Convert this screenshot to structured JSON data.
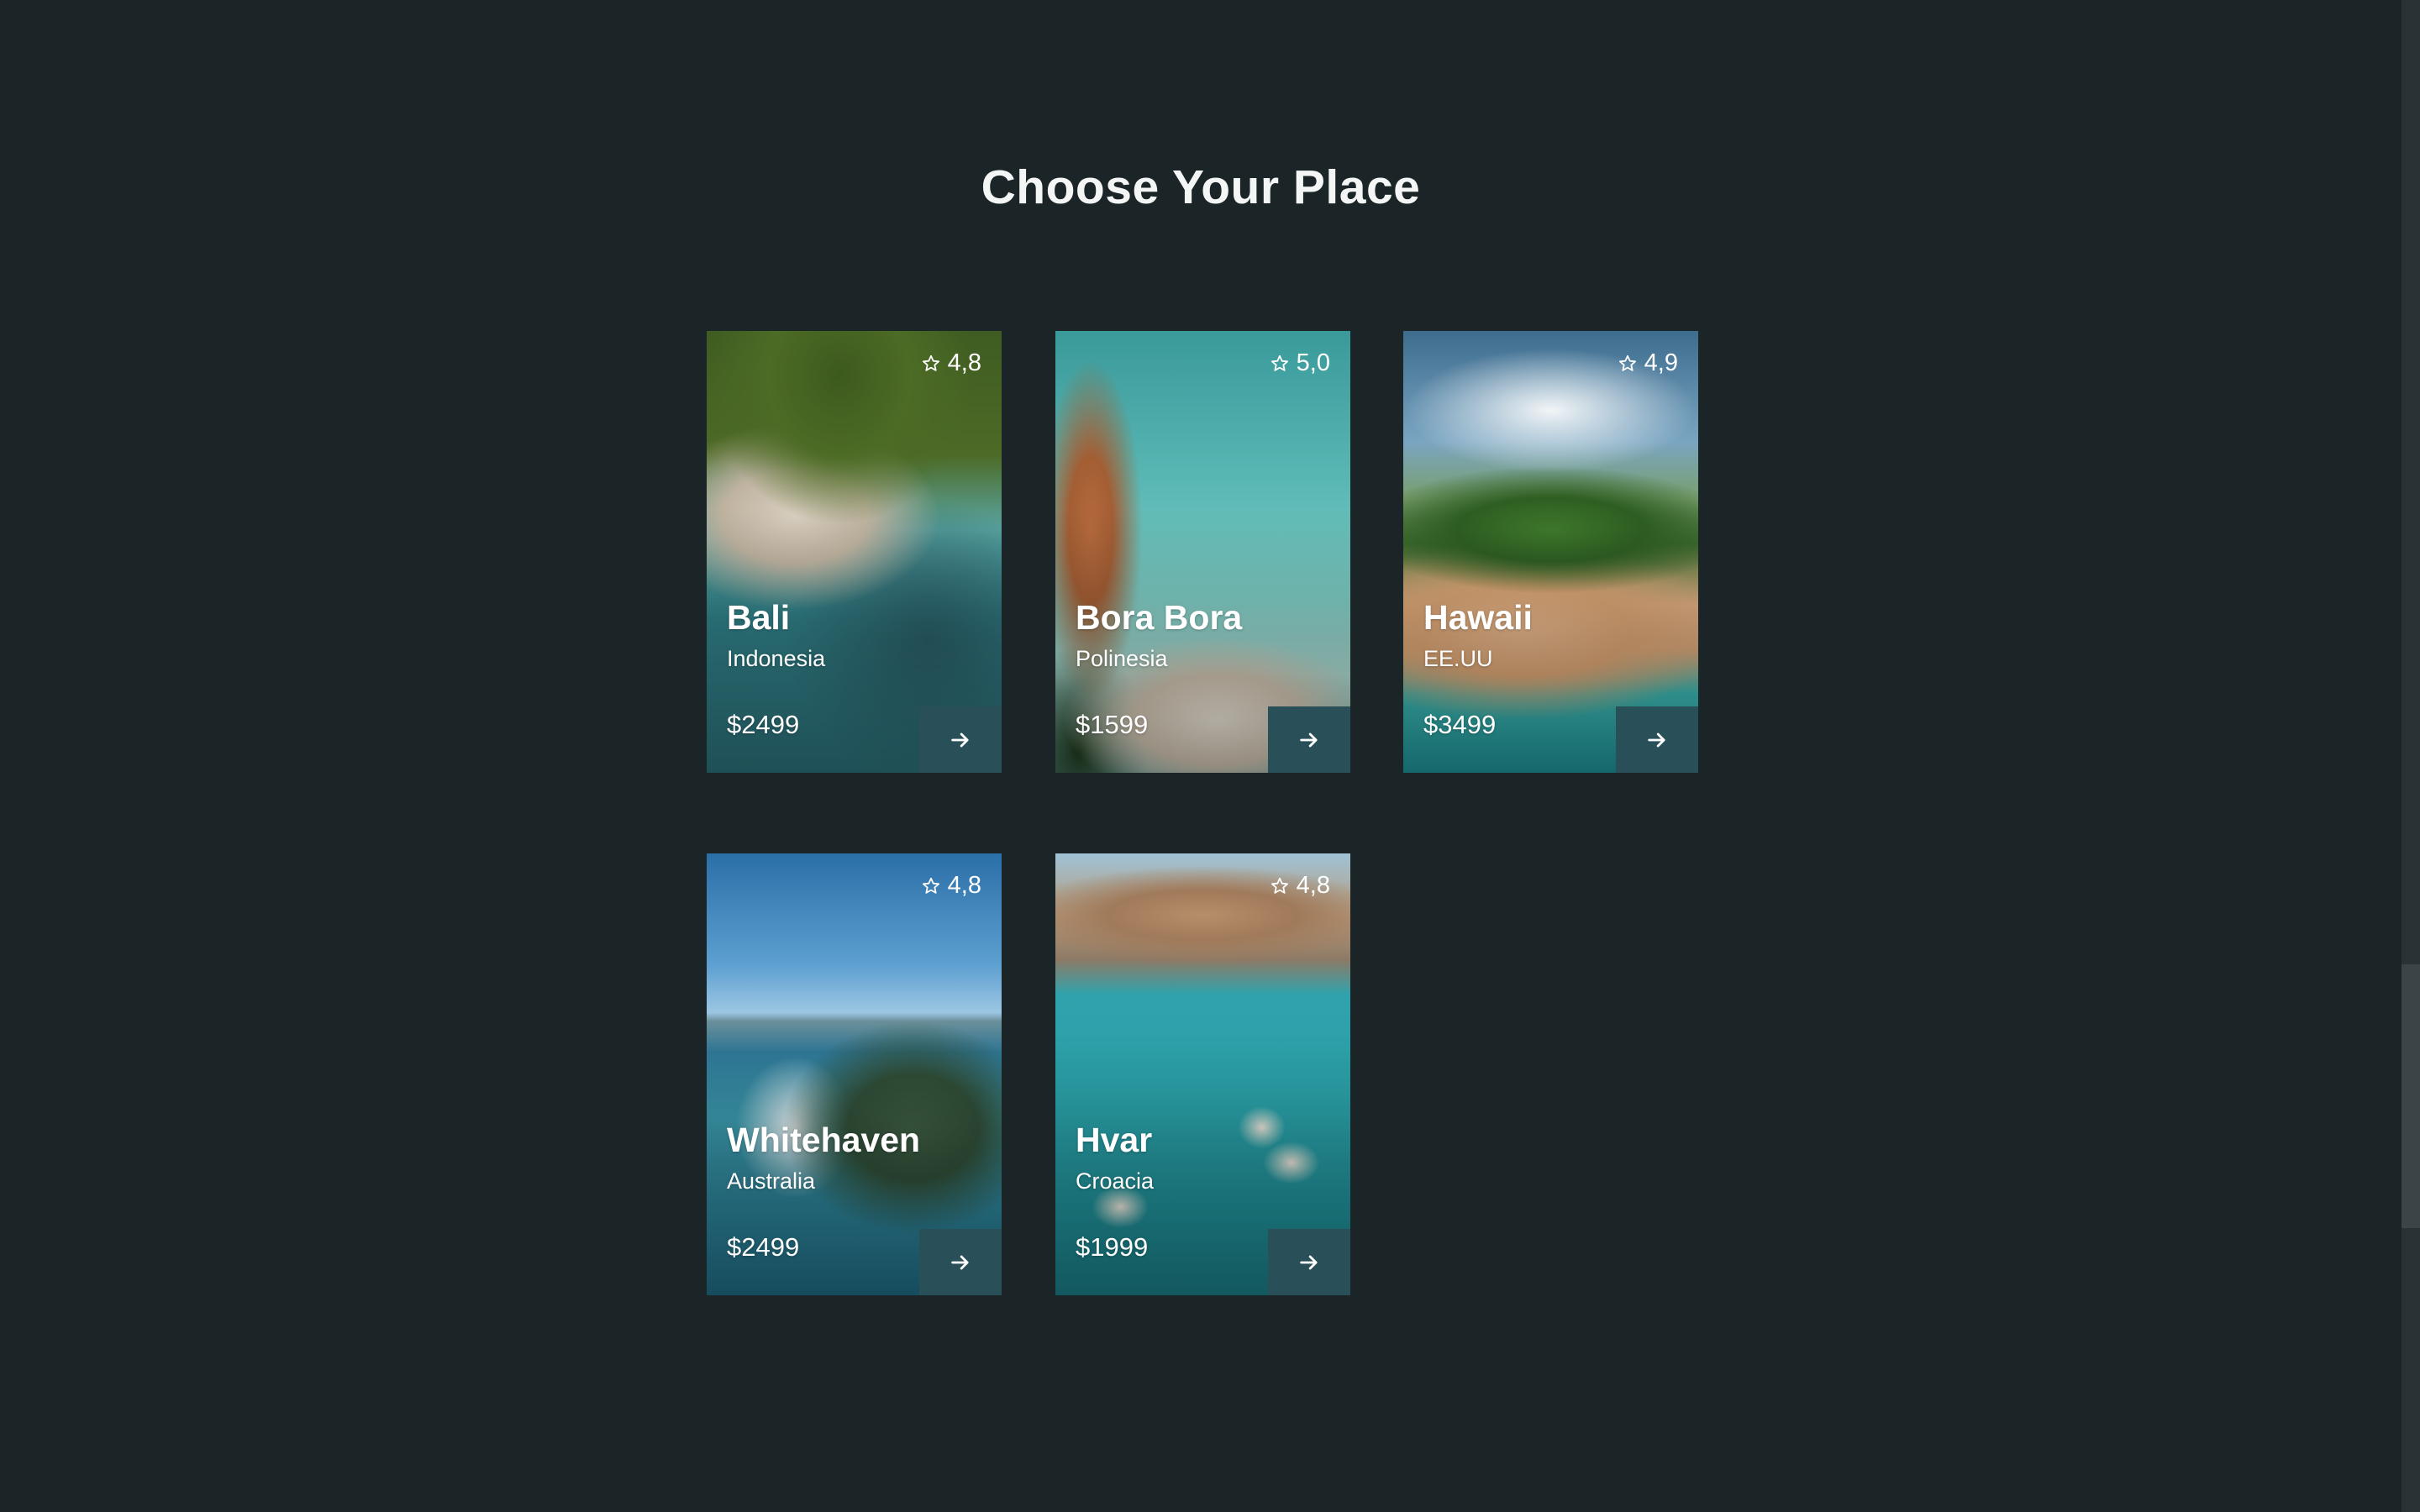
{
  "page": {
    "title": "Choose Your Place"
  },
  "cards": [
    {
      "name": "Bali",
      "country": "Indonesia",
      "price": "$2499",
      "rating": "4,8"
    },
    {
      "name": "Bora Bora",
      "country": "Polinesia",
      "price": "$1599",
      "rating": "5,0"
    },
    {
      "name": "Hawaii",
      "country": "EE.UU",
      "price": "$3499",
      "rating": "4,9"
    },
    {
      "name": "Whitehaven",
      "country": "Australia",
      "price": "$2499",
      "rating": "4,8"
    },
    {
      "name": "Hvar",
      "country": "Croacia",
      "price": "$1999",
      "rating": "4,8"
    }
  ],
  "icons": {
    "rating": "star-outline-icon",
    "card_action": "arrow-right-icon"
  },
  "colors": {
    "background": "#1b2427",
    "button": "#295059",
    "text": "#ffffff"
  }
}
